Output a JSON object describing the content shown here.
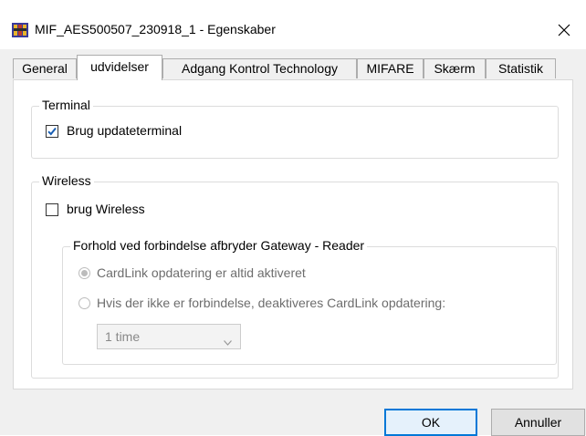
{
  "window": {
    "title": "MIF_AES500507_230918_1 - Egenskaber",
    "app_icon": "app-icon",
    "close_glyph": "✕"
  },
  "tabs": [
    {
      "label": "General",
      "active": false
    },
    {
      "label": "udvidelser",
      "active": true
    },
    {
      "label": "Adgang Kontrol Technology",
      "active": false
    },
    {
      "label": "MIFARE",
      "active": false
    },
    {
      "label": "Skærm",
      "active": false
    },
    {
      "label": "Statistik",
      "active": false
    }
  ],
  "terminal": {
    "group_label": "Terminal",
    "checkbox_label": "Brug updateterminal",
    "checked": true
  },
  "wireless": {
    "group_label": "Wireless",
    "checkbox_label": "brug Wireless",
    "checked": false,
    "connection": {
      "group_label": "Forhold ved forbindelse afbryder Gateway - Reader",
      "option_always": "CardLink opdatering er altid aktiveret",
      "option_deactivate": "Hvis der ikke er forbindelse, deaktiveres CardLink opdatering:",
      "selected_option": "always",
      "duration_value": "1 time"
    }
  },
  "buttons": {
    "ok": "OK",
    "cancel": "Annuller"
  },
  "colors": {
    "accent": "#0078d7",
    "check": "#1a5fb4"
  }
}
